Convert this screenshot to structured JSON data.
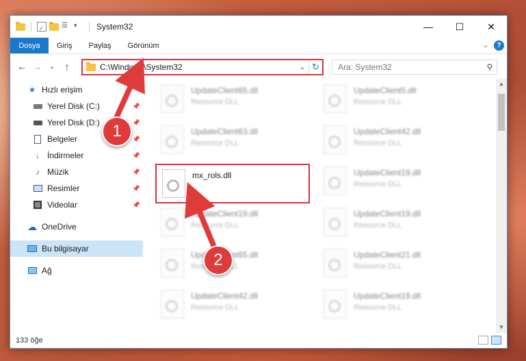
{
  "window": {
    "title": "System32",
    "controls": {
      "minimize": "—",
      "maximize": "☐",
      "close": "✕"
    }
  },
  "ribbon": {
    "file_tab": "Dosya",
    "tabs": [
      "Giriş",
      "Paylaş",
      "Görünüm"
    ],
    "expand_chevron": "⌄",
    "help_label": "?"
  },
  "nav": {
    "back": "←",
    "forward": "→",
    "recent": "⌄",
    "up": "↑",
    "address": "C:\\Windows\\System32",
    "search_placeholder": "Ara: System32"
  },
  "sidebar": {
    "items": [
      {
        "label": "Hızlı erişim",
        "icon": "star-icon"
      },
      {
        "label": "Yerel Disk (C:)",
        "icon": "drive-icon",
        "pinned": true
      },
      {
        "label": "Yerel Disk (D:)",
        "icon": "drive-icon",
        "pinned": true
      },
      {
        "label": "Belgeler",
        "icon": "documents-icon",
        "pinned": true
      },
      {
        "label": "İndirmeler",
        "icon": "download-icon",
        "pinned": true
      },
      {
        "label": "Müzik",
        "icon": "music-icon",
        "pinned": true
      },
      {
        "label": "Resimler",
        "icon": "pictures-icon",
        "pinned": true
      },
      {
        "label": "Videolar",
        "icon": "videos-icon",
        "pinned": true
      },
      {
        "label": "OneDrive",
        "icon": "cloud-icon"
      },
      {
        "label": "Bu bilgisayar",
        "icon": "computer-icon",
        "selected": true
      },
      {
        "label": "Ağ",
        "icon": "network-icon"
      }
    ]
  },
  "files": [
    {
      "name": "UpdateClient65.dll",
      "type": "Resource DLL"
    },
    {
      "name": "UpdateClient5.dll",
      "type": "Resource DLL"
    },
    {
      "name": "UpdateClient63.dll",
      "type": "Resource DLL"
    },
    {
      "name": "UpdateClient42.dll",
      "type": "Resource DLL"
    },
    {
      "name": "mx_rols.dll",
      "type": ""
    },
    {
      "name": "UpdateClient19.dll",
      "type": "Resource DLL"
    },
    {
      "name": "UpdateClient19.dll",
      "type": "Resource DLL"
    },
    {
      "name": "UpdateClient19.dll",
      "type": "Resource DLL"
    },
    {
      "name": "UpdateClient65.dll",
      "type": "Resource DLL"
    },
    {
      "name": "UpdateClient21.dll",
      "type": "Resource DLL"
    },
    {
      "name": "UpdateClient42.dll",
      "type": "Resource DLL"
    },
    {
      "name": "UpdateClient19.dll",
      "type": "Resource DLL"
    }
  ],
  "status": {
    "count": "133 öğe"
  },
  "callouts": {
    "one": "1",
    "two": "2"
  },
  "colors": {
    "accent": "#1979ca",
    "highlight": "#d8333b",
    "callout": "#e03b3b"
  }
}
